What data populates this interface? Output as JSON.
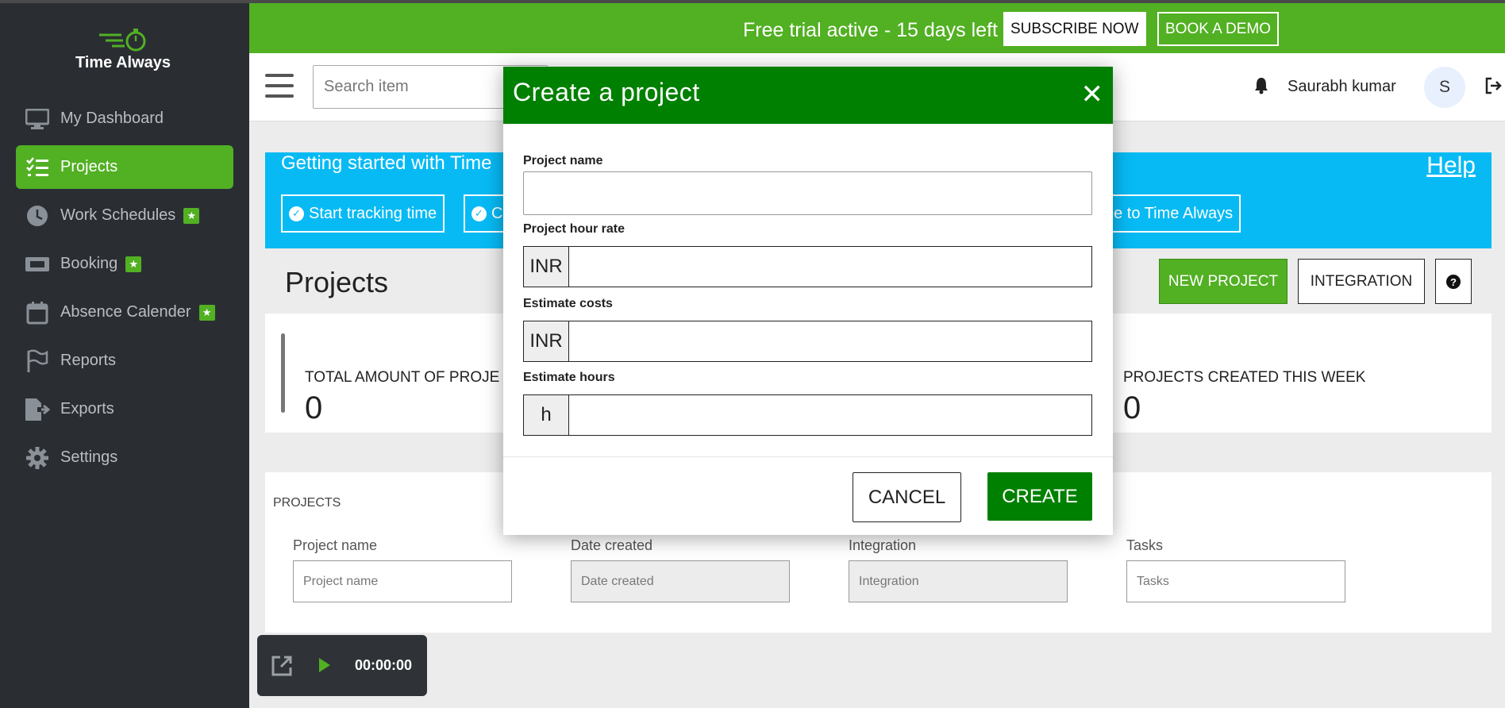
{
  "app": {
    "name": "Time Always"
  },
  "sidebar": {
    "items": [
      {
        "label": "My Dashboard",
        "icon": "monitor-icon",
        "active": false,
        "star": false
      },
      {
        "label": "Projects",
        "icon": "checklist-icon",
        "active": true,
        "star": false
      },
      {
        "label": "Work Schedules",
        "icon": "clock-icon",
        "active": false,
        "star": true
      },
      {
        "label": "Booking",
        "icon": "ticket-icon",
        "active": false,
        "star": true
      },
      {
        "label": "Absence Calender",
        "icon": "calendar-icon",
        "active": false,
        "star": true
      },
      {
        "label": "Reports",
        "icon": "flag-icon",
        "active": false,
        "star": false
      },
      {
        "label": "Exports",
        "icon": "export-file-icon",
        "active": false,
        "star": false
      },
      {
        "label": "Settings",
        "icon": "gear-icon",
        "active": false,
        "star": false
      }
    ]
  },
  "trial": {
    "text": "Free trial active - 15 days left",
    "subscribe_label": "SUBSCRIBE NOW",
    "demo_label": "BOOK A DEMO"
  },
  "topbar": {
    "search_placeholder": "Search item",
    "user_name": "Saurabh kumar",
    "avatar_initial": "S"
  },
  "banner": {
    "title": "Getting started with Time",
    "help_label": "Help",
    "chips": [
      {
        "label": "Start tracking time"
      },
      {
        "label": "C"
      },
      {
        "label": "be to Time Always"
      }
    ]
  },
  "page": {
    "title": "Projects",
    "new_project_label": "NEW PROJECT",
    "integration_label": "INTEGRATION"
  },
  "stats": [
    {
      "label": "TOTAL AMOUNT OF PROJE",
      "value": "0"
    },
    {
      "label": "PROJECTS CREATED THIS WEEK",
      "value": "0"
    }
  ],
  "projects_table": {
    "heading": "PROJECTS",
    "filters": [
      {
        "label": "Project name",
        "placeholder": "Project name"
      },
      {
        "label": "Date created",
        "placeholder": "Date created"
      },
      {
        "label": "Integration",
        "placeholder": "Integration"
      },
      {
        "label": "Tasks",
        "placeholder": "Tasks"
      }
    ]
  },
  "timer": {
    "time": "00:00:00"
  },
  "modal": {
    "title": "Create a project",
    "close_glyph": "✕",
    "fields": {
      "project_name_label": "Project name",
      "hour_rate_label": "Project hour rate",
      "hour_rate_addon": "INR",
      "estimate_costs_label": "Estimate costs",
      "estimate_costs_addon": "INR",
      "estimate_hours_label": "Estimate hours",
      "estimate_hours_addon": "h"
    },
    "cancel_label": "CANCEL",
    "create_label": "CREATE"
  },
  "colors": {
    "brand_green": "#52b023",
    "modal_green": "#008000",
    "banner_blue": "#07baf4",
    "sidebar_bg": "#2a2e33"
  }
}
